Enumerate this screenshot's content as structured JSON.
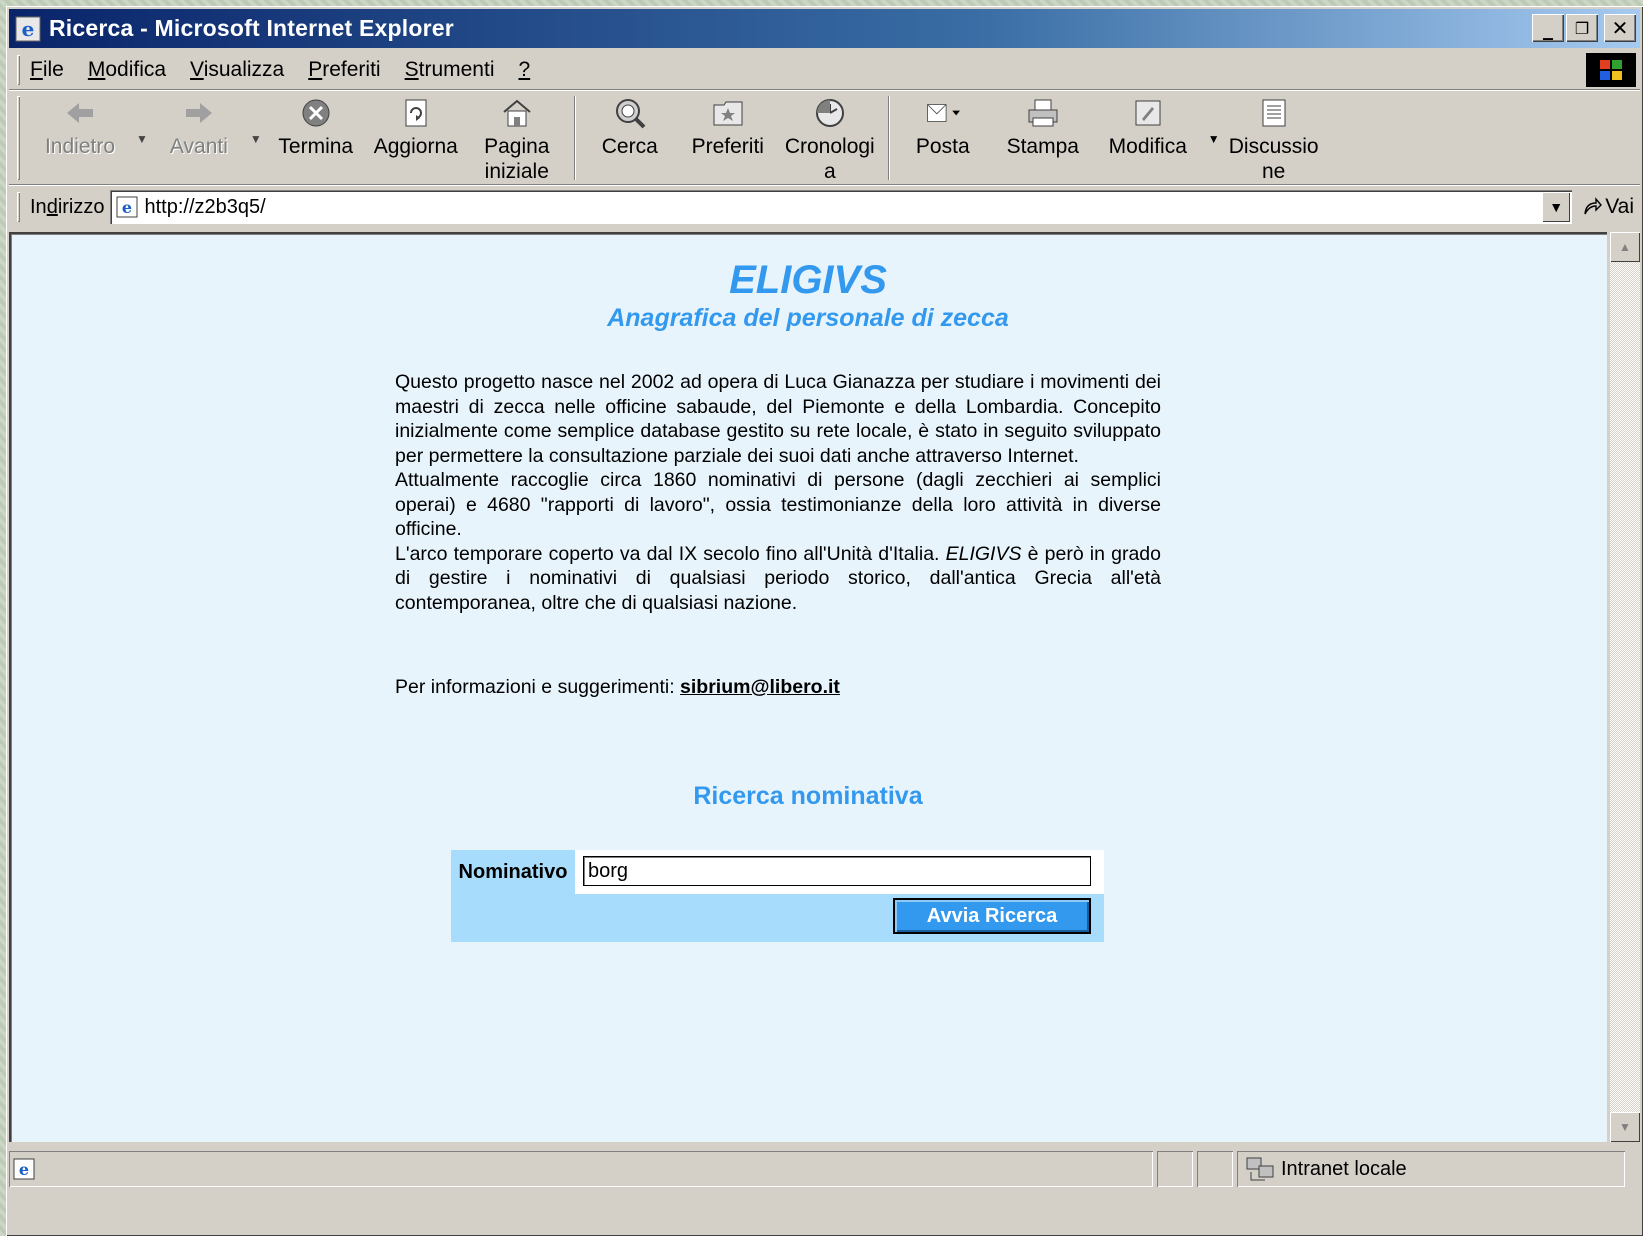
{
  "window": {
    "title": "Ricerca - Microsoft Internet Explorer",
    "buttons": {
      "minimize": "_",
      "restore": "❐",
      "close": "✕"
    }
  },
  "menu": {
    "items": [
      {
        "label": "File",
        "key": "F",
        "rest": "ile"
      },
      {
        "label": "Modifica",
        "key": "M",
        "rest": "odifica"
      },
      {
        "label": "Visualizza",
        "key": "V",
        "rest": "isualizza"
      },
      {
        "label": "Preferiti",
        "key": "P",
        "rest": "referiti"
      },
      {
        "label": "Strumenti",
        "key": "S",
        "rest": "trumenti"
      },
      {
        "label": "?",
        "key": "?",
        "rest": ""
      }
    ]
  },
  "toolbar": {
    "back": "Indietro",
    "forward": "Avanti",
    "stop": "Termina",
    "refresh": "Aggiorna",
    "home_line1": "Pagina",
    "home_line2": "iniziale",
    "search": "Cerca",
    "favorites": "Preferiti",
    "history_line1": "Cronologi",
    "history_line2": "a",
    "mail": "Posta",
    "print": "Stampa",
    "edit": "Modifica",
    "discuss_line1": "Discussio",
    "discuss_line2": "ne"
  },
  "address": {
    "label_pre": "In",
    "label_key": "d",
    "label_post": "irizzo",
    "url": "http://z2b3q5/",
    "go": "Vai"
  },
  "page": {
    "title": "ELIGIVS",
    "subtitle": "Anagrafica del personale di zecca",
    "paragraph1": "Questo progetto nasce nel 2002 ad opera di Luca Gianazza per studiare i movimenti dei maestri di zecca nelle officine sabaude, del Piemonte e della Lombardia. Concepito inizialmente come semplice database gestito su rete locale, è stato in seguito sviluppato per permettere la consultazione parziale dei suoi dati anche attraverso Internet.",
    "paragraph2": "Attualmente raccoglie circa 1860 nominativi di persone (dagli zecchieri ai semplici operai) e 4680 \"rapporti di lavoro\", ossia testimonianze della loro attività in diverse officine.",
    "paragraph3_pre": "L'arco temporare coperto va dal IX secolo fino all'Unità d'Italia. ",
    "paragraph3_em": "ELIGIVS",
    "paragraph3_post": " è però in grado di gestire i nominativi di qualsiasi periodo storico, dall'antica Grecia all'età contemporanea, oltre che di qualsiasi nazione.",
    "contact_label": "Per informazioni e suggerimenti: ",
    "contact_email": "sibrium@libero.it",
    "search_heading": "Ricerca nominativa",
    "form": {
      "label": "Nominativo",
      "value": "borg",
      "submit": "Avvia Ricerca"
    }
  },
  "status": {
    "zone": "Intranet locale"
  },
  "colors": {
    "accent": "#3399ee",
    "form_bg": "#a8dcfc",
    "content_bg": "#e8f4fc"
  }
}
